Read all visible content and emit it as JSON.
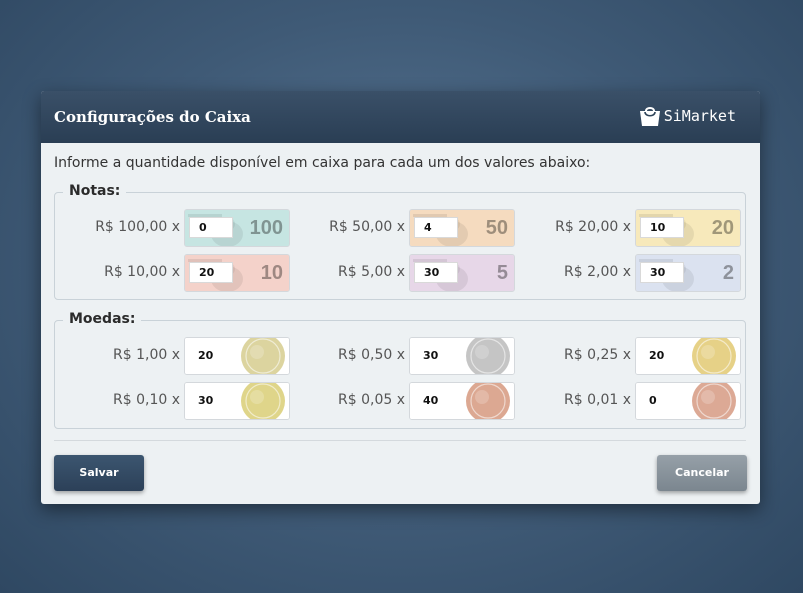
{
  "dialog": {
    "title": "Configurações do Caixa",
    "brand": "SiMarket",
    "instruction": "Informe a quantidade disponível em caixa para cada um dos valores abaixo:"
  },
  "notes": {
    "legend": "Notas:",
    "items": [
      {
        "label": "R$ 100,00 x",
        "value": "0",
        "color": "#9fd4cf",
        "digits": "100",
        "icon": "banknote-100-icon"
      },
      {
        "label": "R$ 50,00 x",
        "value": "4",
        "color": "#f3c391",
        "digits": "50",
        "icon": "banknote-50-icon"
      },
      {
        "label": "R$ 20,00 x",
        "value": "10",
        "color": "#f5dc8a",
        "digits": "20",
        "icon": "banknote-20-icon"
      },
      {
        "label": "R$ 10,00 x",
        "value": "20",
        "color": "#f2b3a4",
        "digits": "10",
        "icon": "banknote-10-icon"
      },
      {
        "label": "R$ 5,00 x",
        "value": "30",
        "color": "#d9bcd9",
        "digits": "5",
        "icon": "banknote-5-icon"
      },
      {
        "label": "R$ 2,00 x",
        "value": "30",
        "color": "#c4d0e8",
        "digits": "2",
        "icon": "banknote-2-icon"
      }
    ]
  },
  "coins": {
    "legend": "Moedas:",
    "items": [
      {
        "label": "R$ 1,00 x",
        "value": "20",
        "color": "#d8cf95",
        "icon": "coin-1-real-icon"
      },
      {
        "label": "R$ 0,50 x",
        "value": "30",
        "color": "#bfbfbf",
        "icon": "coin-50-centavos-icon"
      },
      {
        "label": "R$ 0,25 x",
        "value": "20",
        "color": "#e3cc7a",
        "icon": "coin-25-centavos-icon"
      },
      {
        "label": "R$ 0,10 x",
        "value": "30",
        "color": "#dcd07d",
        "icon": "coin-10-centavos-icon"
      },
      {
        "label": "R$ 0,05 x",
        "value": "40",
        "color": "#d89f86",
        "icon": "coin-5-centavos-icon"
      },
      {
        "label": "R$ 0,01 x",
        "value": "0",
        "color": "#d8a08a",
        "icon": "coin-1-centavo-icon"
      }
    ]
  },
  "buttons": {
    "save": "Salvar",
    "cancel": "Cancelar"
  }
}
